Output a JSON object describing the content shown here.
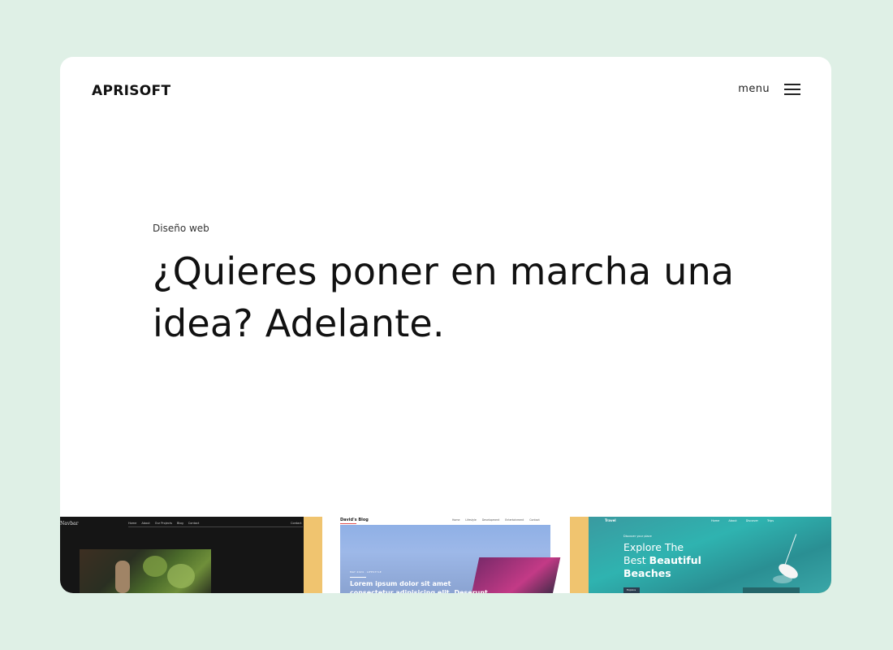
{
  "header": {
    "logo": "APRISOFT",
    "menu_label": "menu"
  },
  "hero": {
    "kicker": "Diseño web",
    "title": "¿Quieres poner en marcha una idea? Adelante."
  },
  "thumbnails": {
    "navbar_theme": {
      "brand": "Navbar",
      "links": [
        "Home",
        "About",
        "Our Projects",
        "Blog",
        "Contact"
      ],
      "contact": "Contact"
    },
    "blog_theme": {
      "brand": "David's Blog",
      "links": [
        "Home",
        "Lifestyle",
        "Development",
        "Entertainment",
        "Contact"
      ],
      "meta": "MAY 2024 · LIFESTYLE",
      "headline": "Lorem ipsum dolor sit amet consectetur adipisicing elit. Deserunt, molestiae?"
    },
    "travel_theme": {
      "brand": "Travel",
      "links": [
        "Home",
        "About",
        "Discover",
        "Trips"
      ],
      "small_label": "Discover your place",
      "headline_prefix": "Explore The",
      "headline_mid": "Best",
      "headline_bold": "Beautiful Beaches",
      "cta": "Explore"
    }
  },
  "colors": {
    "background": "#dff0e6",
    "card": "#ffffff",
    "text": "#111111",
    "accent_gold": "#f0c46f"
  }
}
